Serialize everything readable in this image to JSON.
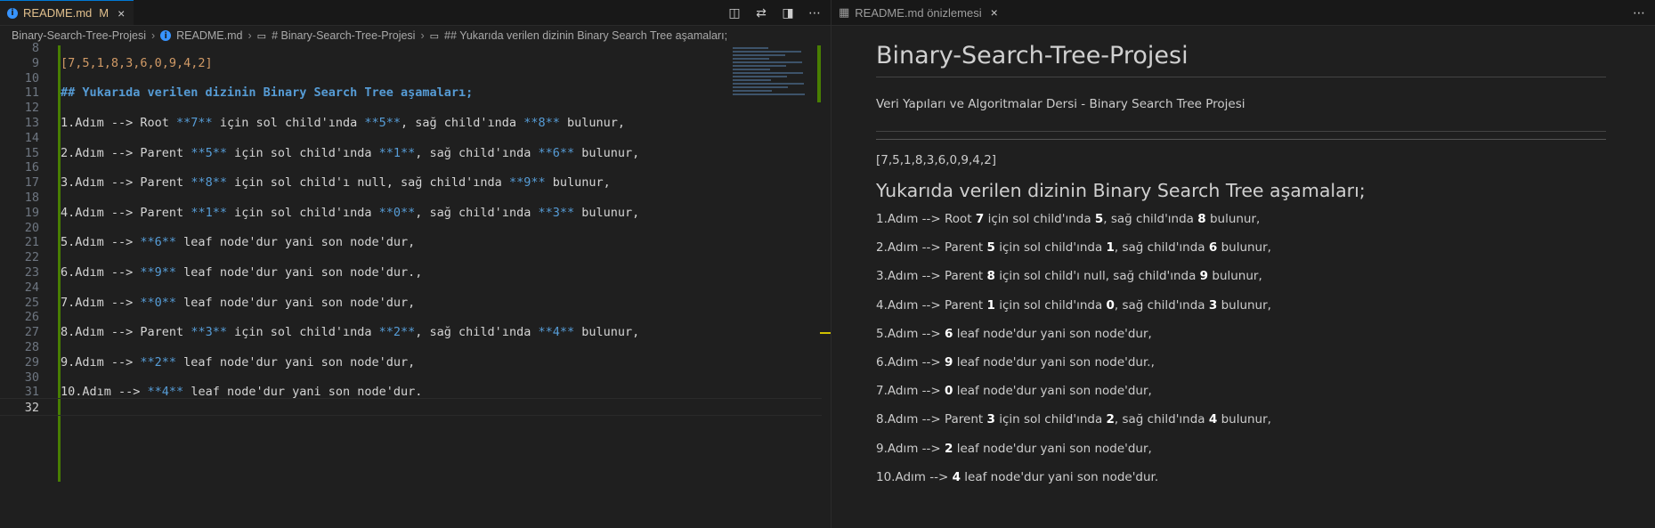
{
  "left_tab": {
    "label": "README.md",
    "modified": "M",
    "close": "×"
  },
  "right_tab": {
    "label": "README.md önizlemesi",
    "close": "×"
  },
  "breadcrumb": {
    "root": "Binary-Search-Tree-Projesi",
    "file": "README.md",
    "h1": "# Binary-Search-Tree-Projesi",
    "h2": "## Yukarıda verilen dizinin Binary Search Tree aşamaları;"
  },
  "editor": {
    "lines": [
      {
        "n": "8",
        "text": ""
      },
      {
        "n": "9",
        "text": "[7,5,1,8,3,6,0,9,4,2]"
      },
      {
        "n": "10",
        "text": ""
      },
      {
        "n": "11",
        "text": "## Yukarıda verilen dizinin Binary Search Tree aşamaları;"
      },
      {
        "n": "12",
        "text": ""
      },
      {
        "n": "13",
        "pre": "1.Adım --> Root ",
        "b1": "**7**",
        "mid": " için sol child'ında ",
        "b2": "**5**",
        "mid2": ", sağ child'ında ",
        "b3": "**8**",
        "post": " bulunur,"
      },
      {
        "n": "14",
        "text": ""
      },
      {
        "n": "15",
        "pre": "2.Adım --> Parent ",
        "b1": "**5**",
        "mid": " için sol child'ında ",
        "b2": "**1**",
        "mid2": ", sağ child'ında ",
        "b3": "**6**",
        "post": " bulunur,"
      },
      {
        "n": "16",
        "text": ""
      },
      {
        "n": "17",
        "pre": "3.Adım --> Parent ",
        "b1": "**8**",
        "mid": " için sol child'ı null, sağ child'ında ",
        "b2": "**9**",
        "mid2": " bulunur,",
        "b3": "",
        "post": ""
      },
      {
        "n": "18",
        "text": ""
      },
      {
        "n": "19",
        "pre": "4.Adım --> Parent ",
        "b1": "**1**",
        "mid": " için sol child'ında ",
        "b2": "**0**",
        "mid2": ", sağ child'ında ",
        "b3": "**3**",
        "post": " bulunur,"
      },
      {
        "n": "20",
        "text": ""
      },
      {
        "n": "21",
        "pre": "5.Adım --> ",
        "b1": "**6**",
        "mid": " leaf node'dur yani son node'dur,",
        "b2": "",
        "mid2": "",
        "b3": "",
        "post": ""
      },
      {
        "n": "22",
        "text": ""
      },
      {
        "n": "23",
        "pre": "6.Adım --> ",
        "b1": "**9**",
        "mid": " leaf node'dur yani son node'dur.,",
        "b2": "",
        "mid2": "",
        "b3": "",
        "post": ""
      },
      {
        "n": "24",
        "text": ""
      },
      {
        "n": "25",
        "pre": "7.Adım --> ",
        "b1": "**0**",
        "mid": " leaf node'dur yani son node'dur,",
        "b2": "",
        "mid2": "",
        "b3": "",
        "post": ""
      },
      {
        "n": "26",
        "text": ""
      },
      {
        "n": "27",
        "pre": "8.Adım --> Parent ",
        "b1": "**3**",
        "mid": " için sol child'ında ",
        "b2": "**2**",
        "mid2": ", sağ child'ında ",
        "b3": "**4**",
        "post": " bulunur,"
      },
      {
        "n": "28",
        "text": ""
      },
      {
        "n": "29",
        "pre": "9.Adım --> ",
        "b1": "**2**",
        "mid": " leaf node'dur yani son node'dur,",
        "b2": "",
        "mid2": "",
        "b3": "",
        "post": ""
      },
      {
        "n": "30",
        "text": ""
      },
      {
        "n": "31",
        "pre": "10.Adım --> ",
        "b1": "**4**",
        "mid": " leaf node'dur yani son node'dur.",
        "b2": "",
        "mid2": "",
        "b3": "",
        "post": ""
      },
      {
        "n": "32",
        "text": ""
      }
    ]
  },
  "preview": {
    "title": "Binary-Search-Tree-Projesi",
    "subtitle": "Veri Yapıları ve Algoritmalar Dersi - Binary Search Tree Projesi",
    "array": "[7,5,1,8,3,6,0,9,4,2]",
    "heading": "Yukarıda verilen dizinin Binary Search Tree aşamaları;",
    "steps": [
      {
        "a": "1.Adım --> Root ",
        "b": "7",
        "c": " için sol child'ında ",
        "d": "5",
        "e": ", sağ child'ında ",
        "f": "8",
        "g": " bulunur,"
      },
      {
        "a": "2.Adım --> Parent ",
        "b": "5",
        "c": " için sol child'ında ",
        "d": "1",
        "e": ", sağ child'ında ",
        "f": "6",
        "g": " bulunur,"
      },
      {
        "a": "3.Adım --> Parent ",
        "b": "8",
        "c": " için sol child'ı null, sağ child'ında ",
        "d": "9",
        "e": " bulunur,",
        "f": "",
        "g": ""
      },
      {
        "a": "4.Adım --> Parent ",
        "b": "1",
        "c": " için sol child'ında ",
        "d": "0",
        "e": ", sağ child'ında ",
        "f": "3",
        "g": " bulunur,"
      },
      {
        "a": "5.Adım --> ",
        "b": "6",
        "c": " leaf node'dur yani son node'dur,",
        "d": "",
        "e": "",
        "f": "",
        "g": ""
      },
      {
        "a": "6.Adım --> ",
        "b": "9",
        "c": " leaf node'dur yani son node'dur.,",
        "d": "",
        "e": "",
        "f": "",
        "g": ""
      },
      {
        "a": "7.Adım --> ",
        "b": "0",
        "c": " leaf node'dur yani son node'dur,",
        "d": "",
        "e": "",
        "f": "",
        "g": ""
      },
      {
        "a": "8.Adım --> Parent ",
        "b": "3",
        "c": " için sol child'ında ",
        "d": "2",
        "e": ", sağ child'ında ",
        "f": "4",
        "g": " bulunur,"
      },
      {
        "a": "9.Adım --> ",
        "b": "2",
        "c": " leaf node'dur yani son node'dur,",
        "d": "",
        "e": "",
        "f": "",
        "g": ""
      },
      {
        "a": "10.Adım --> ",
        "b": "4",
        "c": " leaf node'dur yani son node'dur.",
        "d": "",
        "e": "",
        "f": "",
        "g": ""
      }
    ]
  },
  "icons": {
    "info": "i",
    "preview_toggle": "◫",
    "compare": "⇄",
    "split": "◨",
    "more": "⋯",
    "preview_tab": "▦"
  }
}
